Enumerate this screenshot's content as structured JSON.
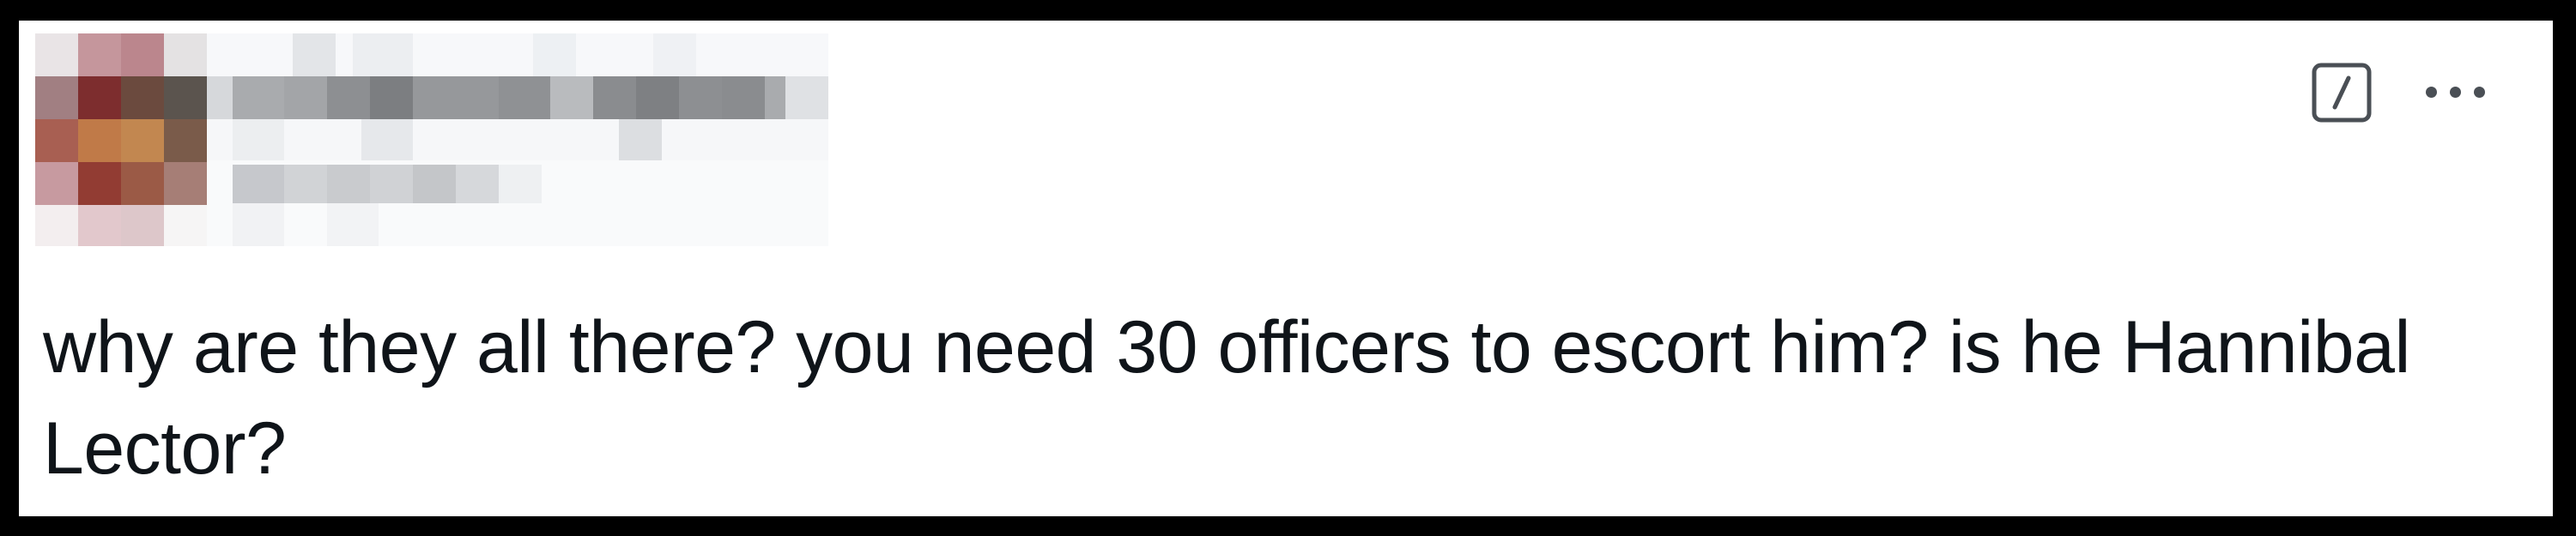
{
  "post": {
    "text": "why are they all there? you need 30 officers to escort him? is he Hannibal Lector?"
  },
  "toolbar": {
    "edit_icon": "edit-icon",
    "more_icon": "more-options-icon"
  },
  "colors": {
    "background": "#000000",
    "card": "#ffffff",
    "text": "#0f1419",
    "icon": "#4a4f55"
  }
}
